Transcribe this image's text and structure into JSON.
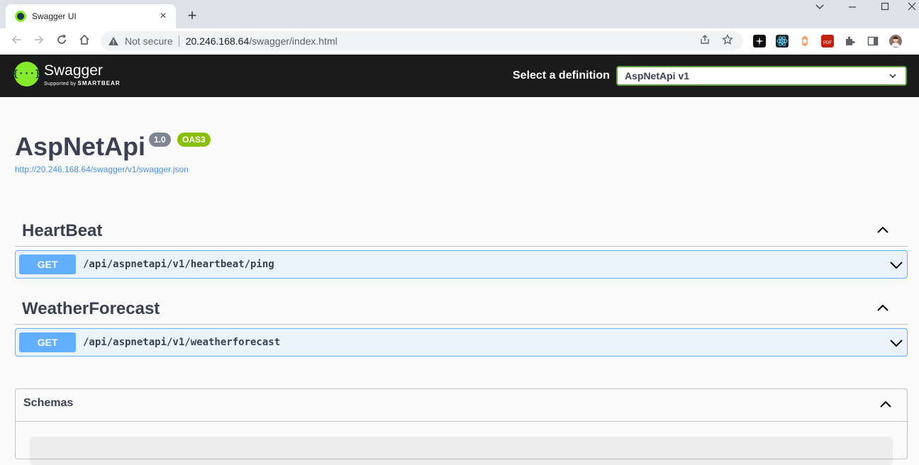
{
  "browser": {
    "tab_title": "Swagger UI",
    "tab_close": "×",
    "new_tab": "+",
    "not_secure": "Not secure",
    "url_host": "20.246.168.64",
    "url_path": "/swagger/index.html"
  },
  "topbar": {
    "logo_title": "Swagger",
    "logo_symbol": "{···}",
    "logo_supported": "Supported by",
    "logo_brand": "SMARTBEAR",
    "select_label": "Select a definition",
    "select_value": "AspNetApi v1"
  },
  "info": {
    "title": "AspNetApi",
    "version": "1.0",
    "oas": "OAS3",
    "spec_url": "http://20.246.168.64/swagger/v1/swagger.json"
  },
  "tags": [
    {
      "name": "HeartBeat",
      "operations": [
        {
          "method": "GET",
          "path": "/api/aspnetapi/v1/heartbeat/ping"
        }
      ]
    },
    {
      "name": "WeatherForecast",
      "operations": [
        {
          "method": "GET",
          "path": "/api/aspnetapi/v1/weatherforecast"
        }
      ]
    }
  ],
  "schemas": {
    "title": "Schemas"
  },
  "colors": {
    "get": "#61affe",
    "swagger_green": "#85ea2d",
    "select_border": "#62a03f",
    "version_badge": "#7d8492",
    "oas_badge": "#89bf04"
  }
}
